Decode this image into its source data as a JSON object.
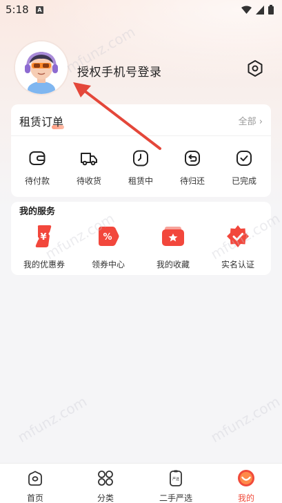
{
  "status_bar": {
    "time": "5:18",
    "notif": "A"
  },
  "header": {
    "login_label": "授权手机号登录"
  },
  "orders": {
    "title": "租赁订单",
    "all_label": "全部",
    "all_chevron": "›",
    "items": [
      {
        "label": "待付款",
        "icon": "wallet-icon"
      },
      {
        "label": "待收货",
        "icon": "truck-icon"
      },
      {
        "label": "租赁中",
        "icon": "clock-icon"
      },
      {
        "label": "待归还",
        "icon": "return-icon"
      },
      {
        "label": "已完成",
        "icon": "check-icon"
      }
    ]
  },
  "services": {
    "title": "我的服务",
    "items": [
      {
        "label": "我的优惠券",
        "icon": "coupon-icon"
      },
      {
        "label": "领券中心",
        "icon": "discount-icon"
      },
      {
        "label": "我的收藏",
        "icon": "favorites-icon"
      },
      {
        "label": "实名认证",
        "icon": "verified-icon"
      }
    ]
  },
  "watermark": "mfunz.com",
  "nav": {
    "items": [
      {
        "label": "首页",
        "icon": "home-icon"
      },
      {
        "label": "分类",
        "icon": "category-icon"
      },
      {
        "label": "二手严选",
        "icon": "secondhand-icon"
      },
      {
        "label": "我的",
        "icon": "profile-icon",
        "active": true
      }
    ]
  },
  "colors": {
    "accent": "#f04a3a",
    "service_red": "#f2473c"
  }
}
